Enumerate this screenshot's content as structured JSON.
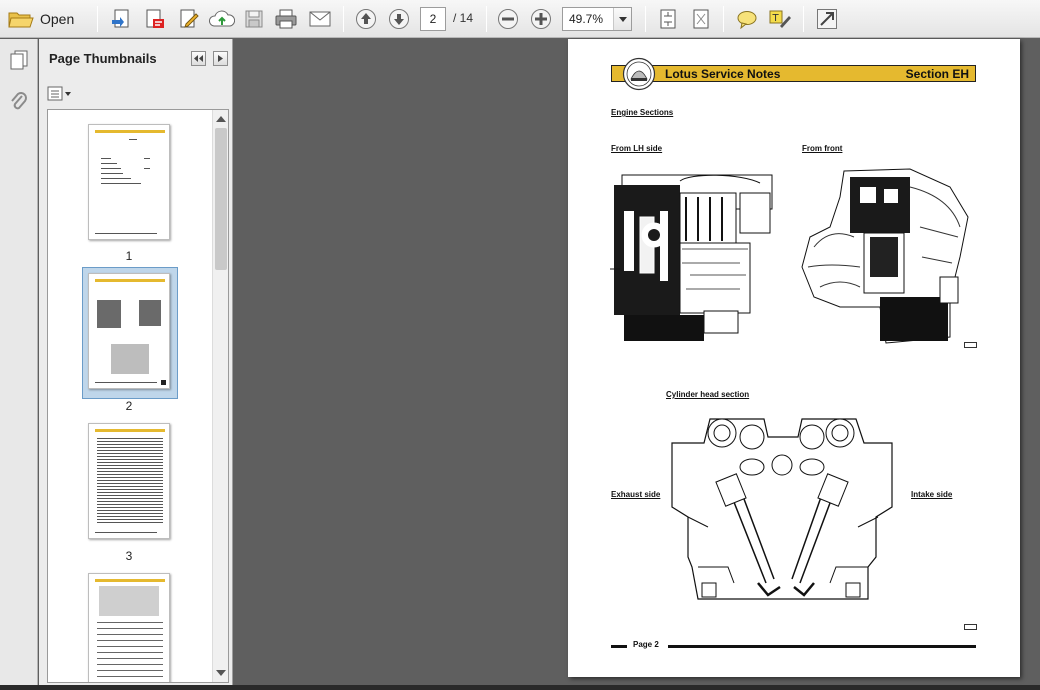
{
  "toolbar": {
    "open_label": "Open",
    "current_page": "2",
    "total_pages": "/ 14",
    "zoom": "49.7%"
  },
  "sidebar": {
    "title": "Page Thumbnails",
    "thumbnails": [
      {
        "label": "1"
      },
      {
        "label": "2"
      },
      {
        "label": "3"
      }
    ]
  },
  "page": {
    "header_title": "Lotus Service Notes",
    "header_section": "Section EH",
    "heading": "Engine Sections",
    "left_view_label": "From LH side",
    "front_view_label": "From front",
    "cylinder_head_label": "Cylinder head section",
    "exhaust_label": "Exhaust side",
    "intake_label": "Intake side",
    "footer": "Page 2"
  },
  "colors": {
    "header_band": "#e5b92f",
    "selection": "#bfd6ea"
  }
}
